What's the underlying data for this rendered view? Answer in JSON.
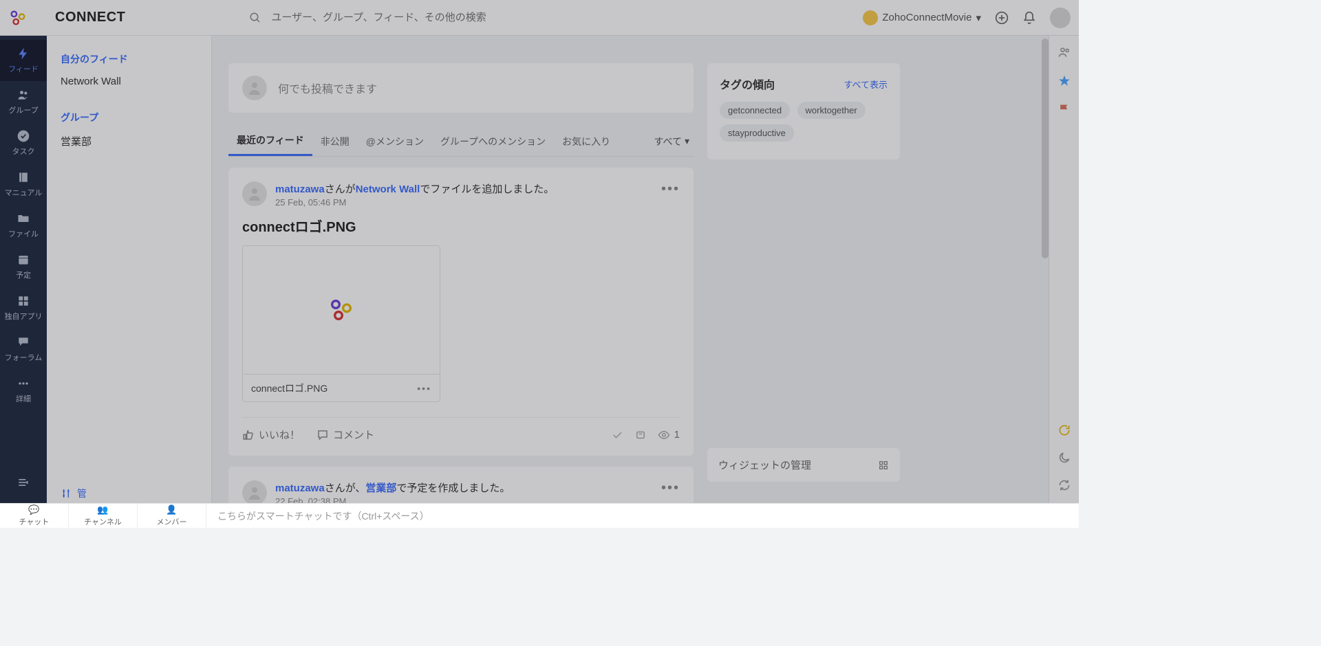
{
  "brand": "CONNECT",
  "search": {
    "placeholder": "ユーザー、グループ、フィード、その他の検索"
  },
  "network": {
    "name": "ZohoConnectMovie"
  },
  "nav": [
    {
      "label": "フィード"
    },
    {
      "label": "グループ"
    },
    {
      "label": "タスク"
    },
    {
      "label": "マニュアル"
    },
    {
      "label": "ファイル"
    },
    {
      "label": "予定"
    },
    {
      "label": "独自アプリ"
    },
    {
      "label": "フォーラム"
    },
    {
      "label": "詳細"
    }
  ],
  "subnav": {
    "heading1": "自分のフィード",
    "item1": "Network Wall",
    "heading2": "グループ",
    "item2": "営業部",
    "footer": "管"
  },
  "composer": {
    "placeholder": "何でも投稿できます"
  },
  "tabs": {
    "t1": "最近のフィード",
    "t2": "非公開",
    "t3": "@メンション",
    "t4": "グループへのメンション",
    "t5": "お気に入り",
    "filter": "すべて"
  },
  "post1": {
    "user": "matuzawa",
    "mid": "さんが",
    "loc": "Network Wall",
    "tail": "でファイルを追加しました。",
    "time": "25 Feb, 05:46 PM",
    "title": "connectロゴ.PNG",
    "filename": "connectロゴ.PNG",
    "like": "いいね！",
    "comment": "コメント",
    "views": "1"
  },
  "post2": {
    "user": "matuzawa",
    "mid": "さんが、",
    "loc": "営業部",
    "tail": "で予定を作成しました。",
    "time": "22 Feb, 02:38 PM"
  },
  "widget": {
    "title": "タグの傾向",
    "all": "すべて表示",
    "tags": {
      "t1": "getconnected",
      "t2": "worktogether",
      "t3": "stayproductive"
    },
    "manage": "ウィジェットの管理"
  },
  "chat": {
    "tab1": "チャット",
    "tab2": "チャンネル",
    "tab3": "メンバー",
    "msg": "こちらがスマートチャットです（Ctrl+スペース）"
  }
}
